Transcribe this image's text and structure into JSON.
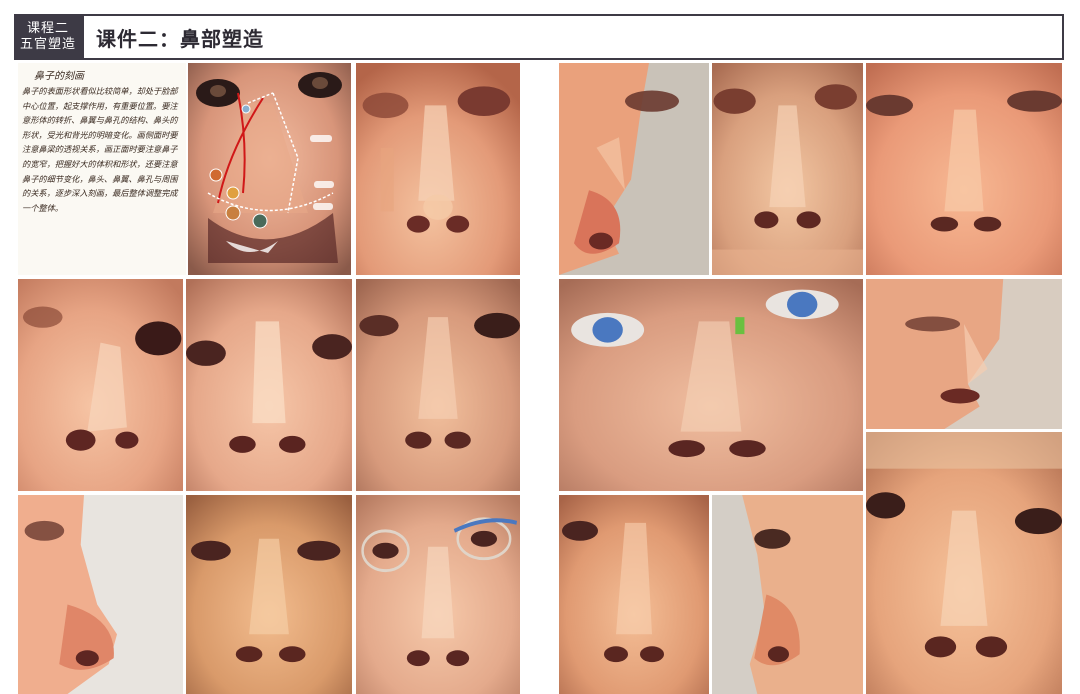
{
  "header": {
    "course_line1": "课程二",
    "course_line2": "五官塑造",
    "title": "课件二：鼻部塑造"
  },
  "notes": {
    "title": "鼻子的刻画",
    "body": "鼻子的表面形状看似比较简单，却处于脸部中心位置，起支撑作用，有重要位置。要注意形体的转折、鼻翼与鼻孔的结构、鼻头的形状，受光和背光的明暗变化。画侧面时要注意鼻梁的透视关系，画正面时要注意鼻子的宽窄，把握好大的体积和形状，还要注意鼻子的细节变化，鼻头、鼻翼、鼻孔与周围的关系，逐步深入刻画，最后整体调整完成一个整体。"
  },
  "palette": {
    "skin_light": "#f0c09a",
    "skin_mid": "#e09a74",
    "skin_dark": "#b8644a",
    "shadow": "#7a3a30",
    "accent_blue": "#4a78c0",
    "header_dark": "#3d3a45"
  }
}
